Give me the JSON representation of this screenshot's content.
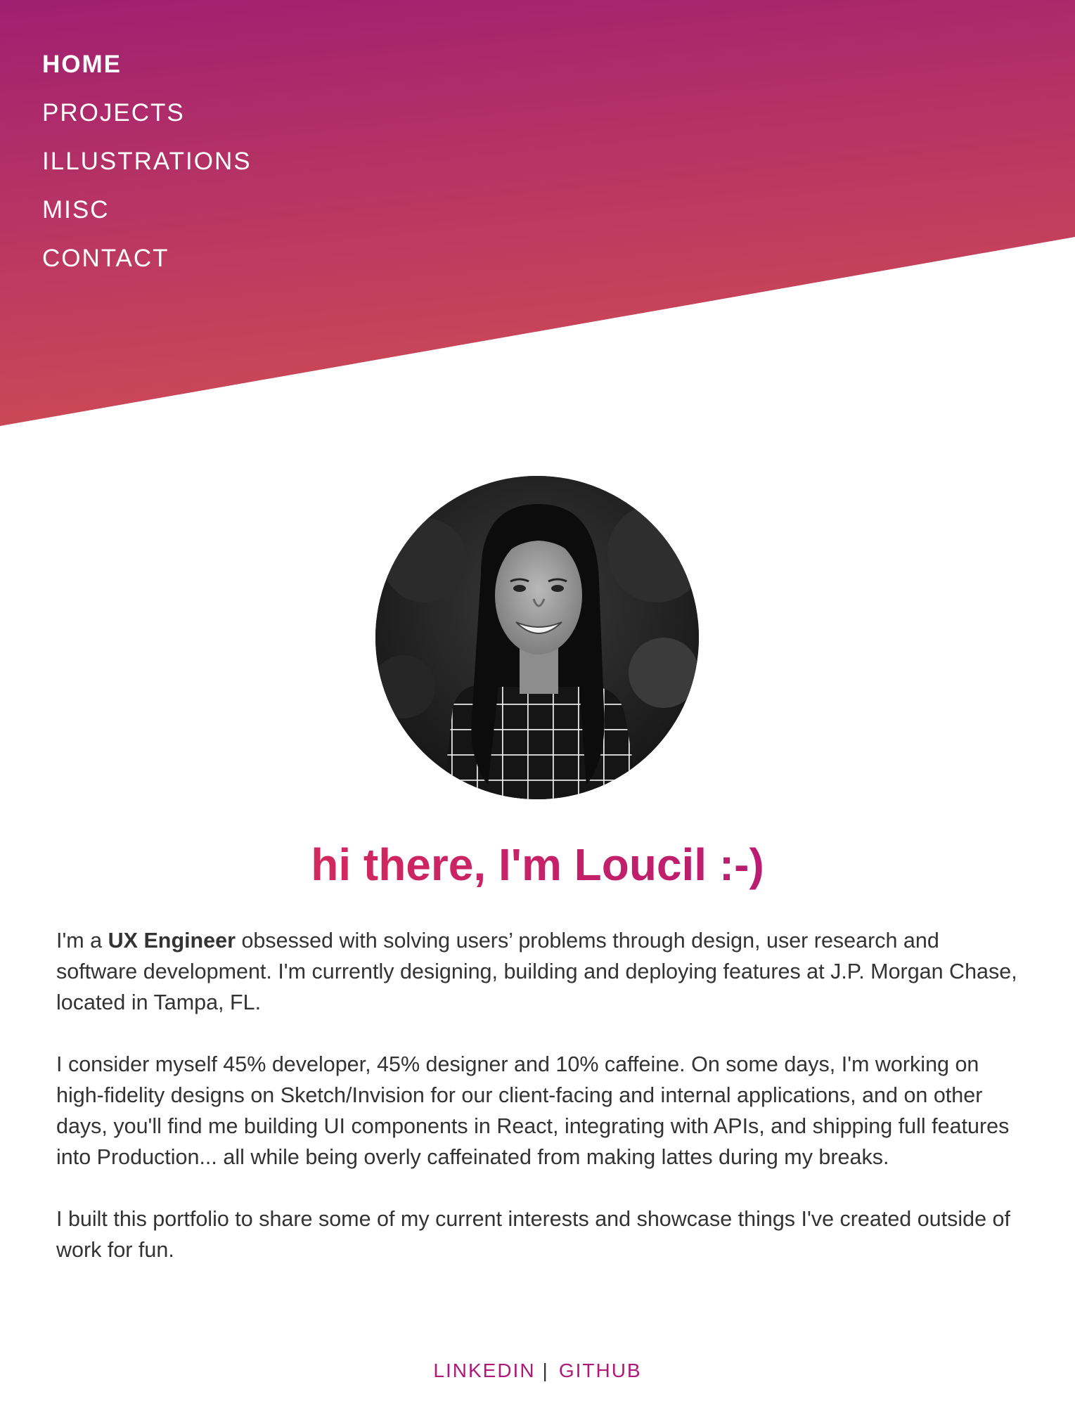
{
  "nav": {
    "items": [
      {
        "label": "HOME",
        "active": true
      },
      {
        "label": "PROJECTS",
        "active": false
      },
      {
        "label": "ILLUSTRATIONS",
        "active": false
      },
      {
        "label": "MISC",
        "active": false
      },
      {
        "label": "CONTACT",
        "active": false
      }
    ]
  },
  "hero": {
    "greeting": "hi there, I'm Loucil :-)"
  },
  "bio": {
    "p1_intro": "I'm a ",
    "p1_role": "UX Engineer",
    "p1_rest": " obsessed with solving users’ problems through design, user research and software development. I'm currently designing, building and deploying features at J.P. Morgan Chase, located in Tampa, FL.",
    "p2": "I consider myself 45% developer, 45% designer and 10% caffeine. On some days, I'm working on high-fidelity designs on Sketch/Invision for our client-facing and internal applications, and on other days, you'll find me building UI components in React, integrating with APIs, and shipping full features into Production... all while being overly caffeinated from making lattes during my breaks.",
    "p3": "I built this portfolio to share some of my current interests and showcase things I've created outside of work for fun."
  },
  "footer": {
    "linkedin_label": "LINKEDIN",
    "separator": "|",
    "github_label": "GITHUB"
  },
  "colors": {
    "gradient_top": "#a11f6f",
    "gradient_bottom": "#cc4a55",
    "greeting_start": "#e2344f",
    "greeting_end": "#a8177e",
    "link": "#b0197a",
    "body_text": "#333333"
  }
}
